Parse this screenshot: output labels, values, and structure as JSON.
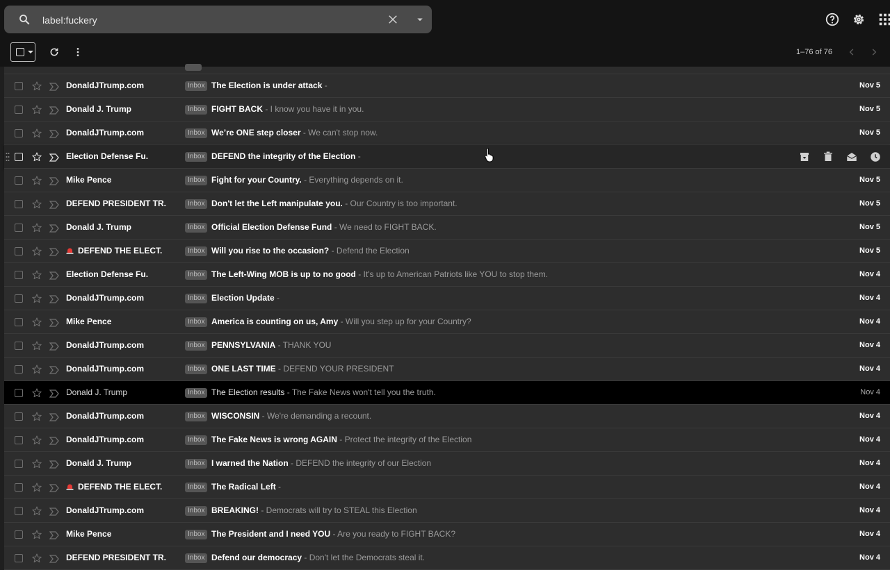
{
  "search": {
    "value": "label:fuckery",
    "placeholder": ""
  },
  "toolbar": {
    "page_count": "1–76 of 76"
  },
  "colors": {
    "background": "#1f1f1f",
    "row": "#2d2d2d",
    "badge": "#555555",
    "selected_row": "#000000"
  },
  "emails": [
    {
      "sender": "DonaldJTrump.com",
      "alert": false,
      "label": "Inbox",
      "subject": "The Election is under attack",
      "snippet": " -",
      "date": "Nov 5",
      "state": "unread"
    },
    {
      "sender": "Donald J. Trump",
      "alert": false,
      "label": "Inbox",
      "subject": "FIGHT BACK",
      "snippet": " - I know you have it in you.",
      "date": "Nov 5",
      "state": "unread"
    },
    {
      "sender": "DonaldJTrump.com",
      "alert": false,
      "label": "Inbox",
      "subject": "We’re ONE step closer",
      "snippet": " - We can't stop now.",
      "date": "Nov 5",
      "state": "unread"
    },
    {
      "sender": "Election Defense Fu.",
      "alert": false,
      "label": "Inbox",
      "subject": "DEFEND the integrity of the Election",
      "snippet": " -",
      "date": "",
      "state": "hover"
    },
    {
      "sender": "Mike Pence",
      "alert": false,
      "label": "Inbox",
      "subject": "Fight for your Country.",
      "snippet": " - Everything depends on it.",
      "date": "Nov 5",
      "state": "unread"
    },
    {
      "sender": "DEFEND PRESIDENT TR.",
      "alert": false,
      "label": "Inbox",
      "subject": "Don't let the Left manipulate you.",
      "snippet": " - Our Country is too important.",
      "date": "Nov 5",
      "state": "unread"
    },
    {
      "sender": "Donald J. Trump",
      "alert": false,
      "label": "Inbox",
      "subject": "Official Election Defense Fund",
      "snippet": " - We need to FIGHT BACK.",
      "date": "Nov 5",
      "state": "unread"
    },
    {
      "sender": "DEFEND THE ELECT.",
      "alert": true,
      "label": "Inbox",
      "subject": "Will you rise to the occasion?",
      "snippet": " - Defend the Election",
      "date": "Nov 5",
      "state": "unread"
    },
    {
      "sender": "Election Defense Fu.",
      "alert": false,
      "label": "Inbox",
      "subject": "The Left-Wing MOB is up to no good",
      "snippet": " - It's up to American Patriots like YOU to stop them.",
      "date": "Nov 4",
      "state": "unread"
    },
    {
      "sender": "DonaldJTrump.com",
      "alert": false,
      "label": "Inbox",
      "subject": "Election Update",
      "snippet": " -",
      "date": "Nov 4",
      "state": "unread"
    },
    {
      "sender": "Mike Pence",
      "alert": false,
      "label": "Inbox",
      "subject": "America is counting on us, Amy",
      "snippet": " - Will you step up for your Country?",
      "date": "Nov 4",
      "state": "unread"
    },
    {
      "sender": "DonaldJTrump.com",
      "alert": false,
      "label": "Inbox",
      "subject": "PENNSYLVANIA",
      "snippet": " - THANK YOU",
      "date": "Nov 4",
      "state": "unread"
    },
    {
      "sender": "DonaldJTrump.com",
      "alert": false,
      "label": "Inbox",
      "subject": "ONE LAST TIME",
      "snippet": " - DEFEND YOUR PRESIDENT",
      "date": "Nov 4",
      "state": "unread"
    },
    {
      "sender": "Donald J. Trump",
      "alert": false,
      "label": "Inbox",
      "subject": "The Election results",
      "snippet": " - The Fake News won't tell you the truth.",
      "date": "Nov 4",
      "state": "selected"
    },
    {
      "sender": "DonaldJTrump.com",
      "alert": false,
      "label": "Inbox",
      "subject": "WISCONSIN",
      "snippet": " - We're demanding a recount.",
      "date": "Nov 4",
      "state": "unread"
    },
    {
      "sender": "DonaldJTrump.com",
      "alert": false,
      "label": "Inbox",
      "subject": "The Fake News is wrong AGAIN",
      "snippet": " - Protect the integrity of the Election",
      "date": "Nov 4",
      "state": "unread"
    },
    {
      "sender": "Donald J. Trump",
      "alert": false,
      "label": "Inbox",
      "subject": "I warned the Nation",
      "snippet": " - DEFEND the integrity of our Election",
      "date": "Nov 4",
      "state": "unread"
    },
    {
      "sender": "DEFEND THE ELECT.",
      "alert": true,
      "label": "Inbox",
      "subject": "The Radical Left",
      "snippet": " -",
      "date": "Nov 4",
      "state": "unread"
    },
    {
      "sender": "DonaldJTrump.com",
      "alert": false,
      "label": "Inbox",
      "subject": "BREAKING!",
      "snippet": " - Democrats will try to STEAL this Election",
      "date": "Nov 4",
      "state": "unread"
    },
    {
      "sender": "Mike Pence",
      "alert": false,
      "label": "Inbox",
      "subject": "The President and I need YOU",
      "snippet": " - Are you ready to FIGHT BACK?",
      "date": "Nov 4",
      "state": "unread"
    },
    {
      "sender": "DEFEND PRESIDENT TR.",
      "alert": false,
      "label": "Inbox",
      "subject": "Defend our democracy",
      "snippet": " - Don't let the Democrats steal it.",
      "date": "Nov 4",
      "state": "unread"
    }
  ]
}
